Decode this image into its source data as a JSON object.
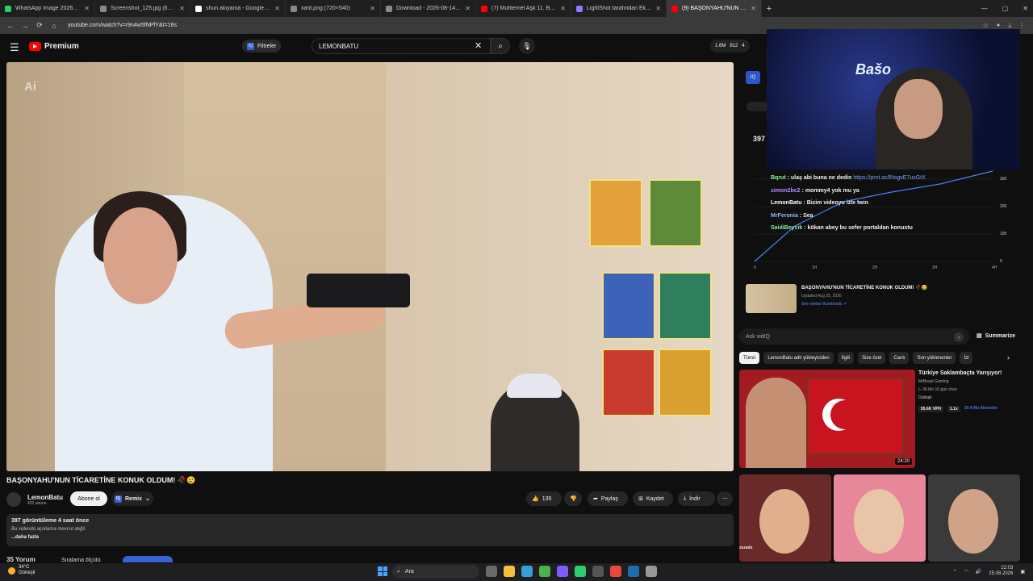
{
  "browser": {
    "tabs": [
      {
        "title": "WhatsApp Image 2026-08-25 a",
        "color": "#25d366",
        "active": false
      },
      {
        "title": "Screenshot_125.jpg (630×892)",
        "color": "#8a8a8a",
        "active": false
      },
      {
        "title": "shun akiyama - Google'da Ara",
        "color": "#ffffff",
        "active": false
      },
      {
        "title": "xant.png (720×540)",
        "color": "#8a8a8a",
        "active": false
      },
      {
        "title": "Download - 2026-08-14T02273",
        "color": "#8a8a8a",
        "active": false
      },
      {
        "title": "(7) Muhtemel Aşk 11. Bölüm 2",
        "color": "#ff0000",
        "active": false
      },
      {
        "title": "LightShot tarafından Ekran Gör",
        "color": "#8a7bff",
        "active": false
      },
      {
        "title": "(9) BAŞONYAHU'NUN TİCARETİ",
        "color": "#ff0000",
        "active": true
      }
    ],
    "url": "youtube.com/watch?v=r9n4w5fNPfY&t=16s"
  },
  "header": {
    "logo": "Premium",
    "filter_label": "Filtreler",
    "filter_badge": "IQ",
    "search_value": "LEMONBATU",
    "stats_views": "1.6M",
    "stats_likes": "812",
    "stats_third": "4"
  },
  "player": {
    "watermark": "Ai"
  },
  "video": {
    "title": "BAŞONYAHU'NUN TİCARETİNE KONUK OLDUM! 🥀😢",
    "channel": "LemonBatu",
    "subscribers": "432 abone",
    "subscribe_label": "Abone ol",
    "remix_label": "Remix",
    "like_count": "135",
    "share_label": "Paylaş",
    "save_label": "Kaydet",
    "download_label": "İndir"
  },
  "description": {
    "views_line": "397 görüntüleme  4 saat önce",
    "no_desc": "Bu videoda açıklama mevcut değil.",
    "more": "...daha fazla"
  },
  "comments": {
    "header": "35 Yorum",
    "sort": "Sıralama ölçütü"
  },
  "side": {
    "iq": "IQ",
    "count": "397",
    "chat": [
      {
        "user": "Bqrut",
        "text": "ulaş abi buna ne dedin",
        "link": "https://prnt.sc/lNsgvE7uxGtX"
      },
      {
        "user": "simon2bc2",
        "text": "mommy4 yok mu ya",
        "link": ""
      },
      {
        "user": "LemonBatu",
        "text": "Bizim videoyu izle twin",
        "link": ""
      },
      {
        "user": "MrFeronia",
        "text": "Sea",
        "link": ""
      },
      {
        "user": "SaidiBeycik",
        "text": "kökan abey bu sefer portaldan konustu",
        "link": ""
      }
    ],
    "stream_sign": "Bašo",
    "chart_y_ticks": [
      "300",
      "200",
      "100",
      "0"
    ],
    "chart_x_ticks": [
      "0",
      "1H",
      "2H",
      "3H",
      "4H"
    ],
    "rec_title": "BAŞONYAHU'NUN TİCARETİNE KONUK OLDUM! 🥀😢",
    "rec_updated": "Updated Aug 25, 2026",
    "rec_link": "See similar thumbnails ↗",
    "ask_placeholder": "Ask vidIQ",
    "summarize": "Summarize",
    "chips": [
      "Tümü",
      "LemonBatu adlı yükleyiciden",
      "İlgili",
      "Size özel",
      "Canlı",
      "Son yüklenenler",
      "İzl"
    ],
    "card": {
      "title": "Türkiye Saklambaçta Yarışıyor!",
      "channel": "MrBeast Gaming",
      "meta": "▷ 36 Mn  10 gün önce",
      "dub": "Dublajlı",
      "duration": "24:20",
      "vph": "55.6K VPH",
      "mult": "1.1x",
      "subs": "39.4 Mn Aboneler"
    },
    "bottom_label": "zezade"
  },
  "taskbar": {
    "temp": "34°C",
    "condition": "Güneşli",
    "search": "Ara",
    "time": "22:03",
    "date": "25.08.2026"
  }
}
